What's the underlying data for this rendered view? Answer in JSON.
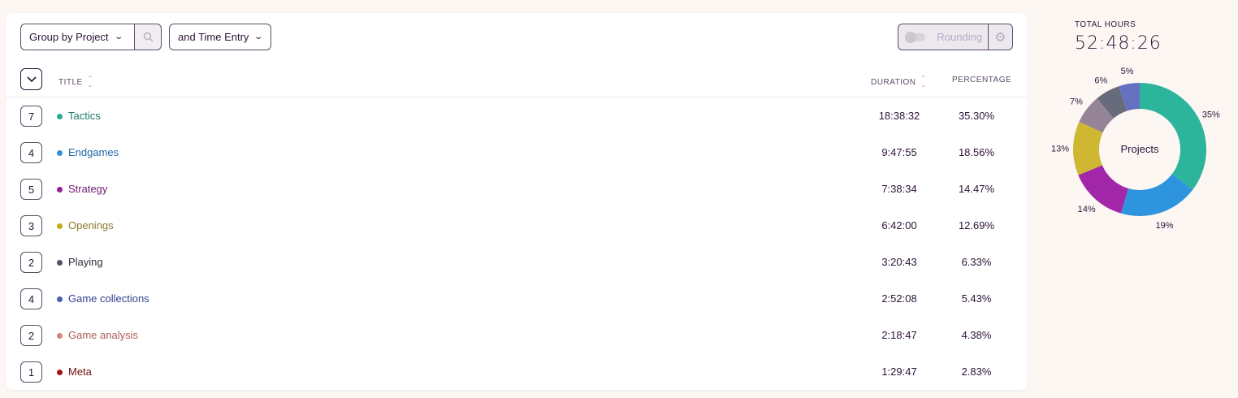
{
  "toolbar": {
    "group_label": "Group by Project",
    "time_entry_label": "and Time Entry",
    "rounding_label": "Rounding"
  },
  "table": {
    "headers": {
      "title": "TITLE",
      "duration": "DURATION",
      "percentage": "PERCENTAGE"
    },
    "rows": [
      {
        "count": "7",
        "name": "Tactics",
        "duration": "18:38:32",
        "percentage": "35.30%",
        "color": "#2aac8e",
        "text_color": "#1a7a68"
      },
      {
        "count": "4",
        "name": "Endgames",
        "duration": "9:47:55",
        "percentage": "18.56%",
        "color": "#2f8fd8",
        "text_color": "#1f66a8"
      },
      {
        "count": "5",
        "name": "Strategy",
        "duration": "7:38:34",
        "percentage": "14.47%",
        "color": "#9b1d9e",
        "text_color": "#6f1a72"
      },
      {
        "count": "3",
        "name": "Openings",
        "duration": "6:42:00",
        "percentage": "12.69%",
        "color": "#c9a81e",
        "text_color": "#8d7a2a"
      },
      {
        "count": "2",
        "name": "Playing",
        "duration": "3:20:43",
        "percentage": "6.33%",
        "color": "#525266",
        "text_color": "#2c2c3a"
      },
      {
        "count": "4",
        "name": "Game collections",
        "duration": "2:52:08",
        "percentage": "5.43%",
        "color": "#4a5fb4",
        "text_color": "#35448f"
      },
      {
        "count": "2",
        "name": "Game analysis",
        "duration": "2:18:47",
        "percentage": "4.38%",
        "color": "#d58576",
        "text_color": "#a86155"
      },
      {
        "count": "1",
        "name": "Meta",
        "duration": "1:29:47",
        "percentage": "2.83%",
        "color": "#a31515",
        "text_color": "#6e0d0d"
      }
    ]
  },
  "summary": {
    "total_label": "TOTAL HOURS",
    "total_value": "52:48:26",
    "donut_center_label": "Projects"
  },
  "chart_data": {
    "type": "pie",
    "categories": [
      "Tactics",
      "Endgames",
      "Strategy",
      "Openings",
      "Playing",
      "Game collections",
      "Game analysis",
      "Meta"
    ],
    "values": [
      35.3,
      18.56,
      14.47,
      12.69,
      6.33,
      5.43,
      4.38,
      2.83
    ],
    "chart_slices": [
      {
        "label": "35%",
        "value": 35,
        "color": "#2db59c"
      },
      {
        "label": "19%",
        "value": 19,
        "color": "#2e94de"
      },
      {
        "label": "14%",
        "value": 14,
        "color": "#a226a8"
      },
      {
        "label": "13%",
        "value": 13,
        "color": "#d0b731"
      },
      {
        "label": "7%",
        "value": 7,
        "color": "#958495"
      },
      {
        "label": "6%",
        "value": 6,
        "color": "#686b7c"
      },
      {
        "label": "5%",
        "value": 5,
        "color": "#6571c0"
      }
    ]
  }
}
